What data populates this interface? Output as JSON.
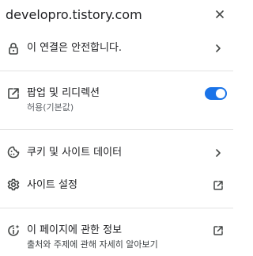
{
  "header": {
    "site": "developro.tistory.com",
    "close_icon": "close-icon"
  },
  "connection": {
    "label": "이 연결은 안전합니다.",
    "icon": "lock-icon"
  },
  "popups": {
    "label": "팝업 및 리디렉션",
    "sub": "허용(기본값)",
    "icon": "open-in-new-icon",
    "toggle_on": true,
    "toggle_color": "#1a73e8"
  },
  "cookies": {
    "label": "쿠키 및 사이트 데이터",
    "icon": "cookie-icon"
  },
  "site_settings": {
    "label": "사이트 설정",
    "icon": "gear-icon"
  },
  "about_page": {
    "label": "이 페이지에 관한 정보",
    "sub": "출처와 주제에 관해 자세히 알아보기",
    "icon": "info-sparkle-icon"
  }
}
